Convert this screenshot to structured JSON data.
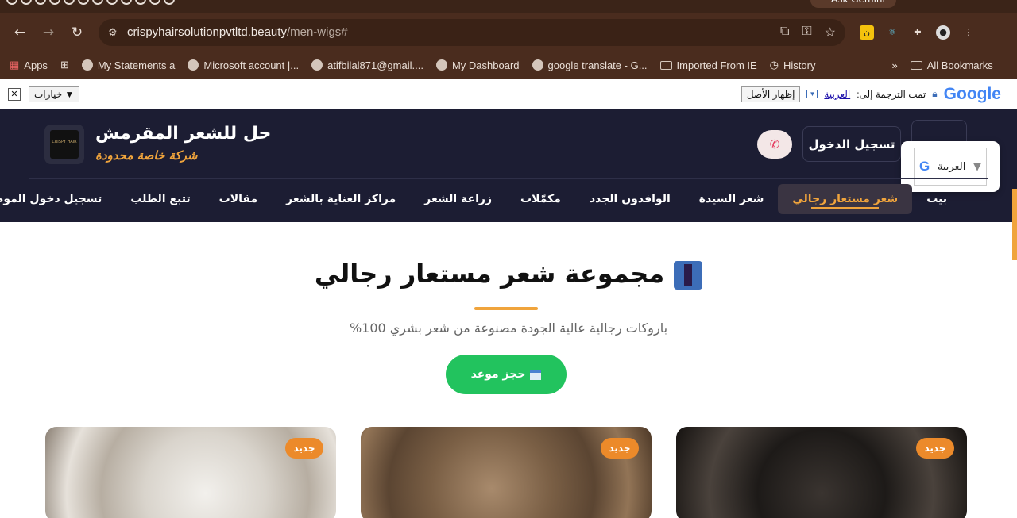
{
  "browser": {
    "gemini_label": "Ask Gemini",
    "url_host": "crispyhairsolutionpvtltd.beauty",
    "url_path": "/men-wigs#",
    "bookmarks": [
      {
        "label": "Apps"
      },
      {
        "label": "My Statements a"
      },
      {
        "label": "Microsoft account |..."
      },
      {
        "label": "atifbilal871@gmail...."
      },
      {
        "label": "My Dashboard"
      },
      {
        "label": "google translate - G..."
      },
      {
        "label": "Imported From IE"
      },
      {
        "label": "History"
      },
      {
        "label": "All Bookmarks"
      }
    ]
  },
  "translate_bar": {
    "options_label": "خيارات ▼",
    "translated_to": "تمت الترجمة إلى:",
    "language": "العربية",
    "show_original": "إظهار الأصل",
    "google": "Google"
  },
  "header": {
    "brand_name": "حل للشعر المقرمش",
    "brand_tag": "شركة خاصة محدودة",
    "logo_text": "CRISPY HAIR",
    "login_label": "تسجيل الدخول",
    "lang_select": "العربية",
    "nav": [
      {
        "label": "بيت"
      },
      {
        "label": "شعر مستعار رجالي",
        "active": true
      },
      {
        "label": "شعر السيدة"
      },
      {
        "label": "الوافدون الجدد"
      },
      {
        "label": "مكمّلات"
      },
      {
        "label": "زراعة الشعر"
      },
      {
        "label": "مراكز العناية بالشعر"
      },
      {
        "label": "مقالات"
      },
      {
        "label": "تتبع الطلب"
      },
      {
        "label": "تسجيل دخول الموظفين"
      }
    ]
  },
  "main": {
    "title": "مجموعة شعر مستعار رجالي",
    "subtitle": "باروكات رجالية عالية الجودة مصنوعة من شعر بشري 100%",
    "book_label": "حجز موعد",
    "cards": [
      {
        "badge": "جديد"
      },
      {
        "badge": "جديد"
      },
      {
        "badge": "جديد"
      }
    ]
  },
  "colors": {
    "header_bg": "#1c1d33",
    "accent": "#f0a43c",
    "book_green": "#22c35e",
    "badge_orange": "#ec8a2a"
  }
}
